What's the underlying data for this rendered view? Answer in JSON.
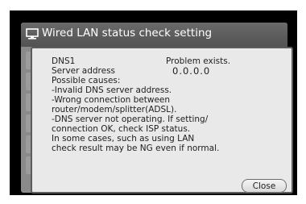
{
  "window": {
    "title": "Wired LAN status check setting",
    "title_icon": "monitor-icon"
  },
  "dialog": {
    "item_label": "DNS1",
    "status": "Problem exists.",
    "field_label": "Server address",
    "field_value": "0.0.0.0",
    "lines": [
      "Possible causes:",
      "-Invalid DNS server address.",
      "-Wrong connection between",
      "router/modem/splitter(ADSL).",
      "-DNS server not operating. If setting/",
      "connection OK, check ISP status.",
      "In some cases, such as using LAN",
      "check result may be NG even if normal."
    ],
    "close_label": "Close"
  }
}
